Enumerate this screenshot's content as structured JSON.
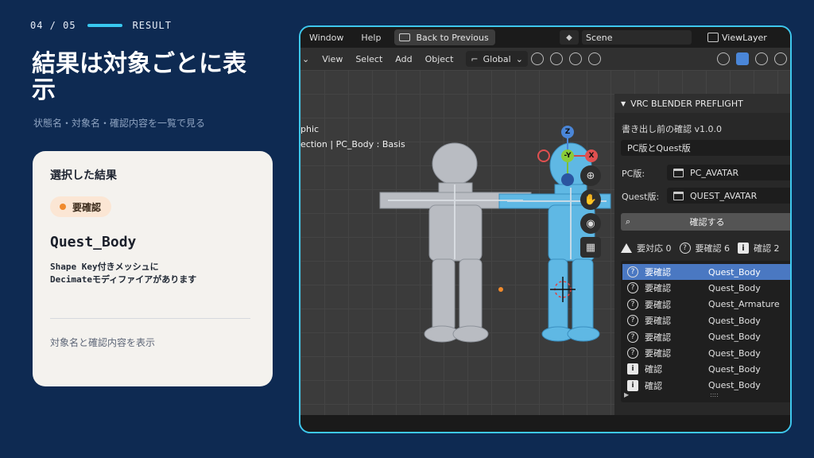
{
  "slide": {
    "step": "04 / 05",
    "step_label": "RESULT",
    "title": "結果は対象ごとに表示",
    "subtitle": "状態名・対象名・確認内容を一覧で見る",
    "accent_color": "#38c8f0",
    "background_color": "#0e2a52"
  },
  "card": {
    "heading": "選択した結果",
    "badge": "要確認",
    "badge_color": "#f08a2c",
    "object_name": "Quest_Body",
    "description_line1": "Shape Key付きメッシュに",
    "description_line2": "Decimateモディファイアがあります",
    "footer": "対象名と確認内容を表示"
  },
  "blender": {
    "menu": {
      "window": "Window",
      "help": "Help",
      "back": "Back to Previous"
    },
    "scene": "Scene",
    "view_layer": "ViewLayer",
    "toolbar": {
      "view": "View",
      "select": "Select",
      "add": "Add",
      "object": "Object",
      "orientation": "Global"
    },
    "viewport_text_1": "phic",
    "viewport_text_2": "ection | PC_Body : Basis",
    "gizmo": {
      "z": "Z",
      "y": "-Y",
      "x": "X"
    },
    "panel": {
      "header": "VRC BLENDER PREFLIGHT",
      "subtitle": "書き出し前の確認  v1.0.0",
      "mode": "PC版とQuest版",
      "pc_label": "PC版:",
      "pc_value": "PC_AVATAR",
      "quest_label": "Quest版:",
      "quest_value": "QUEST_AVATAR",
      "check_button": "確認する",
      "stats": {
        "action": "要対応 0",
        "review": "要確認 6",
        "info": "確認 2"
      },
      "results": [
        {
          "status": "要確認",
          "target": "Quest_Body",
          "icon": "question-icon",
          "selected": true
        },
        {
          "status": "要確認",
          "target": "Quest_Body",
          "icon": "question-icon",
          "selected": false
        },
        {
          "status": "要確認",
          "target": "Quest_Armature",
          "icon": "question-icon",
          "selected": false
        },
        {
          "status": "要確認",
          "target": "Quest_Body",
          "icon": "question-icon",
          "selected": false
        },
        {
          "status": "要確認",
          "target": "Quest_Body",
          "icon": "question-icon",
          "selected": false
        },
        {
          "status": "要確認",
          "target": "Quest_Body",
          "icon": "question-icon",
          "selected": false
        },
        {
          "status": "確認",
          "target": "Quest_Body",
          "icon": "info-icon",
          "selected": false
        },
        {
          "status": "確認",
          "target": "Quest_Body",
          "icon": "info-icon",
          "selected": false
        }
      ]
    }
  }
}
